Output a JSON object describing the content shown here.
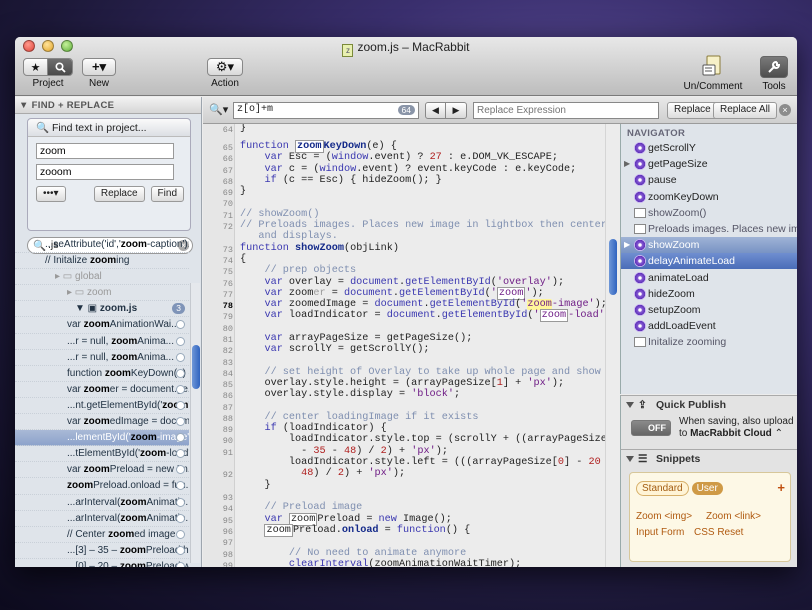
{
  "window": {
    "title": "zoom.js – MacRabbit"
  },
  "toolbar": {
    "project_label": "Project",
    "new_label": "New",
    "action_label": "Action",
    "unc_label": "Un/Comment",
    "tools_label": "Tools"
  },
  "sidebar": {
    "header": "FIND + REPLACE",
    "find_title": "Find text in project...",
    "find_value": "zoom",
    "replace_value": "zooom",
    "options_label": "•••▾",
    "replace_button": "Replace",
    "find_button": "Find",
    "filter_value": ".js",
    "rows": [
      {
        "pre": "...seAttribute('id','",
        "hit": "zoom",
        "post": "-caption');"
      },
      {
        "pre": "// Initalize ",
        "hit": "zoom",
        "post": "ing"
      },
      {
        "pre": "global",
        "hit": "",
        "post": ""
      },
      {
        "pre": "zoom",
        "hit": "",
        "post": ""
      },
      {
        "pre": "zoom.js",
        "hit": "",
        "post": ""
      },
      {
        "pre": "var ",
        "hit": "zoom",
        "post": "AnimationWai..."
      },
      {
        "pre": "...r = null, ",
        "hit": "zoom",
        "post": "Anima..."
      },
      {
        "pre": "...r = null, ",
        "hit": "zoom",
        "post": "Anima..."
      },
      {
        "pre": "function ",
        "hit": "zoom",
        "post": "KeyDown(e) {"
      },
      {
        "pre": "var ",
        "hit": "zoom",
        "post": "er = document.ge..."
      },
      {
        "pre": "...nt.getElementById('",
        "hit": "zoom",
        "post": "');"
      },
      {
        "pre": "var ",
        "hit": "zoom",
        "post": "edImage = docum..."
      },
      {
        "pre": "...lementById('",
        "hit": "zoom",
        "post": "-image');"
      },
      {
        "pre": "...tElementById('",
        "hit": "zoom",
        "post": "-load');"
      },
      {
        "pre": "var ",
        "hit": "zoom",
        "post": "Preload = new Im..."
      },
      {
        "pre": "",
        "hit": "zoom",
        "post": "Preload.onload = fun..."
      },
      {
        "pre": "...arInterval(",
        "hit": "zoom",
        "post": "Animatio..."
      },
      {
        "pre": "...arInterval(",
        "hit": "zoom",
        "post": "Animatio..."
      },
      {
        "pre": "// Center ",
        "hit": "zoom",
        "post": "ed image"
      },
      {
        "pre": "...[3] – 35 – ",
        "hit": "zoom",
        "post": "Preload.h..."
      },
      {
        "pre": "...[0] – 20 – ",
        "hit": "zoom",
        "post": "Preload.w..."
      }
    ],
    "zoomjs_count": "3"
  },
  "findbar": {
    "query": "z[o]+m",
    "count": "64",
    "replace_placeholder": "Replace Expression",
    "replace_button": "Replace",
    "replace_all_button": "Replace All"
  },
  "code": {
    "line_numbers": [
      "64",
      "65",
      "66",
      "67",
      "68",
      "69",
      "70",
      "71",
      "72",
      "73",
      "",
      "74",
      "75",
      "76",
      "77",
      "78",
      "79",
      "80",
      "81",
      "82",
      "83",
      "84",
      "85",
      "86",
      "87",
      "88",
      "89",
      "90",
      "91",
      "",
      "92",
      "",
      "93",
      "94",
      "95",
      "96",
      "97",
      "98",
      "99"
    ]
  },
  "navigator": {
    "header": "NAVIGATOR",
    "items": [
      {
        "label": "getScrollY",
        "type": "fn"
      },
      {
        "label": "getPageSize",
        "type": "fn"
      },
      {
        "label": "pause",
        "type": "fn"
      },
      {
        "label": "zoomKeyDown",
        "type": "fn"
      },
      {
        "label": "showZoom()",
        "type": "cm"
      },
      {
        "label": "Preloads images. Places new im...",
        "type": "cm"
      },
      {
        "label": "showZoom",
        "type": "fn"
      },
      {
        "label": "delayAnimateLoad",
        "type": "fn"
      },
      {
        "label": "animateLoad",
        "type": "fn"
      },
      {
        "label": "hideZoom",
        "type": "fn"
      },
      {
        "label": "setupZoom",
        "type": "fn"
      },
      {
        "label": "addLoadEvent",
        "type": "fn"
      },
      {
        "label": "Initalize zooming",
        "type": "cm"
      }
    ]
  },
  "quick_publish": {
    "title": "Quick Publish",
    "toggle": "OFF",
    "text1": "When saving, also upload",
    "text2": "to ",
    "target": "MacRabbit Cloud"
  },
  "snippets": {
    "title": "Snippets",
    "tab_standard": "Standard",
    "tab_user": "User",
    "add": "+",
    "items": [
      "Zoom <img>",
      "Zoom <link>",
      "Input Form",
      "CSS Reset"
    ]
  }
}
